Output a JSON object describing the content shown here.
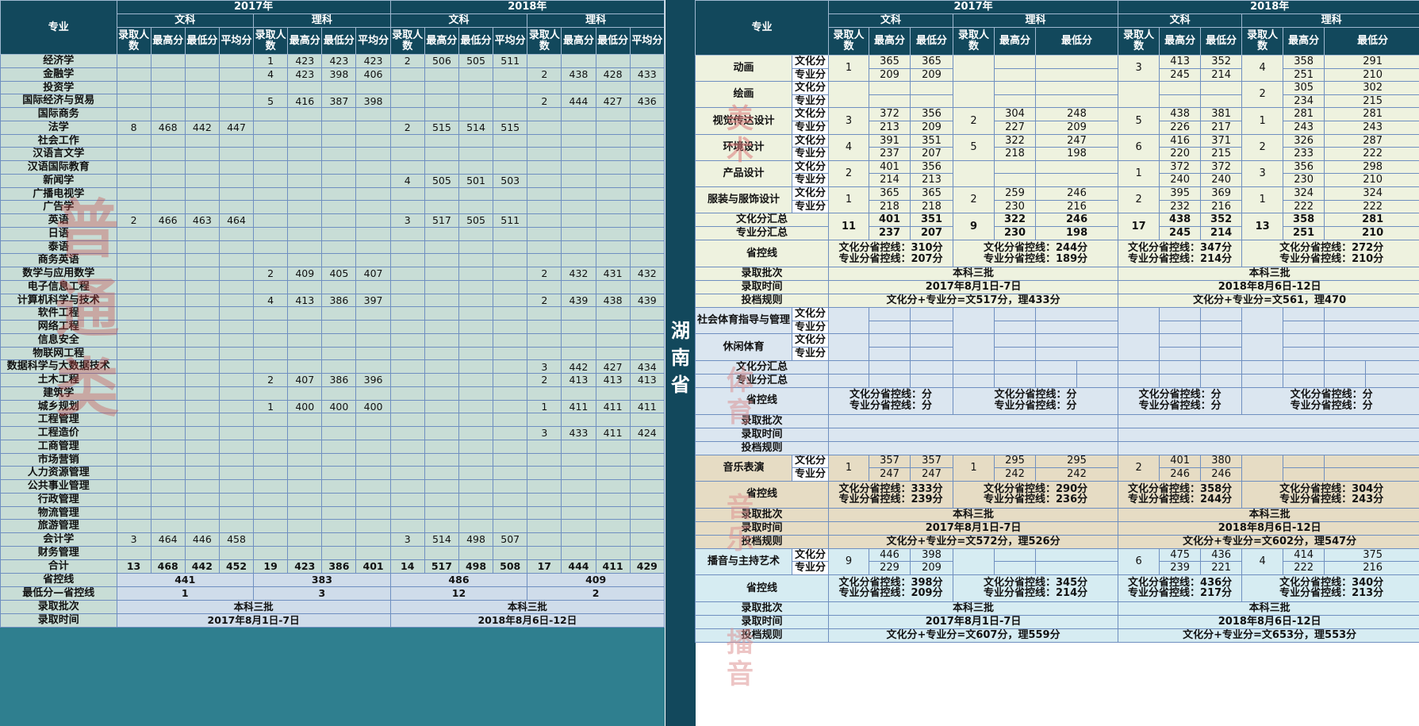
{
  "province": "湖南省",
  "left": {
    "header": {
      "major": "专业",
      "years": [
        "2017年",
        "2018年"
      ],
      "tracks": [
        "文科",
        "理科"
      ],
      "cols": [
        "录取人数",
        "最高分",
        "最低分",
        "平均分"
      ]
    },
    "rows": [
      {
        "name": "经济学",
        "v": [
          "",
          "",
          "",
          "",
          "1",
          "423",
          "423",
          "423",
          "2",
          "506",
          "505",
          "511",
          "",
          "",
          "",
          ""
        ]
      },
      {
        "name": "金融学",
        "v": [
          "",
          "",
          "",
          "",
          "4",
          "423",
          "398",
          "406",
          "",
          "",
          "",
          "",
          "2",
          "438",
          "428",
          "433"
        ]
      },
      {
        "name": "投资学",
        "v": [
          "",
          "",
          "",
          "",
          "",
          "",
          "",
          "",
          "",
          "",
          "",
          "",
          "",
          "",
          "",
          ""
        ]
      },
      {
        "name": "国际经济与贸易",
        "v": [
          "",
          "",
          "",
          "",
          "5",
          "416",
          "387",
          "398",
          "",
          "",
          "",
          "",
          "2",
          "444",
          "427",
          "436"
        ]
      },
      {
        "name": "国际商务",
        "v": [
          "",
          "",
          "",
          "",
          "",
          "",
          "",
          "",
          "",
          "",
          "",
          "",
          "",
          "",
          "",
          ""
        ]
      },
      {
        "name": "法学",
        "v": [
          "8",
          "468",
          "442",
          "447",
          "",
          "",
          "",
          "",
          "2",
          "515",
          "514",
          "515",
          "",
          "",
          "",
          ""
        ]
      },
      {
        "name": "社会工作",
        "v": [
          "",
          "",
          "",
          "",
          "",
          "",
          "",
          "",
          "",
          "",
          "",
          "",
          "",
          "",
          "",
          ""
        ]
      },
      {
        "name": "汉语言文学",
        "v": [
          "",
          "",
          "",
          "",
          "",
          "",
          "",
          "",
          "",
          "",
          "",
          "",
          "",
          "",
          "",
          ""
        ]
      },
      {
        "name": "汉语国际教育",
        "v": [
          "",
          "",
          "",
          "",
          "",
          "",
          "",
          "",
          "",
          "",
          "",
          "",
          "",
          "",
          "",
          ""
        ]
      },
      {
        "name": "新闻学",
        "v": [
          "",
          "",
          "",
          "",
          "",
          "",
          "",
          "",
          "4",
          "505",
          "501",
          "503",
          "",
          "",
          "",
          ""
        ]
      },
      {
        "name": "广播电视学",
        "v": [
          "",
          "",
          "",
          "",
          "",
          "",
          "",
          "",
          "",
          "",
          "",
          "",
          "",
          "",
          "",
          ""
        ]
      },
      {
        "name": "广告学",
        "v": [
          "",
          "",
          "",
          "",
          "",
          "",
          "",
          "",
          "",
          "",
          "",
          "",
          "",
          "",
          "",
          ""
        ]
      },
      {
        "name": "英语",
        "v": [
          "2",
          "466",
          "463",
          "464",
          "",
          "",
          "",
          "",
          "3",
          "517",
          "505",
          "511",
          "",
          "",
          "",
          ""
        ]
      },
      {
        "name": "日语",
        "v": [
          "",
          "",
          "",
          "",
          "",
          "",
          "",
          "",
          "",
          "",
          "",
          "",
          "",
          "",
          "",
          ""
        ]
      },
      {
        "name": "泰语",
        "v": [
          "",
          "",
          "",
          "",
          "",
          "",
          "",
          "",
          "",
          "",
          "",
          "",
          "",
          "",
          "",
          ""
        ]
      },
      {
        "name": "商务英语",
        "v": [
          "",
          "",
          "",
          "",
          "",
          "",
          "",
          "",
          "",
          "",
          "",
          "",
          "",
          "",
          "",
          ""
        ]
      },
      {
        "name": "数学与应用数学",
        "v": [
          "",
          "",
          "",
          "",
          "2",
          "409",
          "405",
          "407",
          "",
          "",
          "",
          "",
          "2",
          "432",
          "431",
          "432"
        ]
      },
      {
        "name": "电子信息工程",
        "v": [
          "",
          "",
          "",
          "",
          "",
          "",
          "",
          "",
          "",
          "",
          "",
          "",
          "",
          "",
          "",
          ""
        ]
      },
      {
        "name": "计算机科学与技术",
        "v": [
          "",
          "",
          "",
          "",
          "4",
          "413",
          "386",
          "397",
          "",
          "",
          "",
          "",
          "2",
          "439",
          "438",
          "439"
        ]
      },
      {
        "name": "软件工程",
        "v": [
          "",
          "",
          "",
          "",
          "",
          "",
          "",
          "",
          "",
          "",
          "",
          "",
          "",
          "",
          "",
          ""
        ]
      },
      {
        "name": "网络工程",
        "v": [
          "",
          "",
          "",
          "",
          "",
          "",
          "",
          "",
          "",
          "",
          "",
          "",
          "",
          "",
          "",
          ""
        ]
      },
      {
        "name": "信息安全",
        "v": [
          "",
          "",
          "",
          "",
          "",
          "",
          "",
          "",
          "",
          "",
          "",
          "",
          "",
          "",
          "",
          ""
        ]
      },
      {
        "name": "物联网工程",
        "v": [
          "",
          "",
          "",
          "",
          "",
          "",
          "",
          "",
          "",
          "",
          "",
          "",
          "",
          "",
          "",
          ""
        ]
      },
      {
        "name": "数据科学与大数据技术",
        "v": [
          "",
          "",
          "",
          "",
          "",
          "",
          "",
          "",
          "",
          "",
          "",
          "",
          "3",
          "442",
          "427",
          "434"
        ]
      },
      {
        "name": "土木工程",
        "v": [
          "",
          "",
          "",
          "",
          "2",
          "407",
          "386",
          "396",
          "",
          "",
          "",
          "",
          "2",
          "413",
          "413",
          "413"
        ]
      },
      {
        "name": "建筑学",
        "v": [
          "",
          "",
          "",
          "",
          "",
          "",
          "",
          "",
          "",
          "",
          "",
          "",
          "",
          "",
          "",
          ""
        ]
      },
      {
        "name": "城乡规划",
        "v": [
          "",
          "",
          "",
          "",
          "1",
          "400",
          "400",
          "400",
          "",
          "",
          "",
          "",
          "1",
          "411",
          "411",
          "411"
        ]
      },
      {
        "name": "工程管理",
        "v": [
          "",
          "",
          "",
          "",
          "",
          "",
          "",
          "",
          "",
          "",
          "",
          "",
          "",
          "",
          "",
          ""
        ]
      },
      {
        "name": "工程造价",
        "v": [
          "",
          "",
          "",
          "",
          "",
          "",
          "",
          "",
          "",
          "",
          "",
          "",
          "3",
          "433",
          "411",
          "424"
        ]
      },
      {
        "name": "工商管理",
        "v": [
          "",
          "",
          "",
          "",
          "",
          "",
          "",
          "",
          "",
          "",
          "",
          "",
          "",
          "",
          "",
          ""
        ]
      },
      {
        "name": "市场营销",
        "v": [
          "",
          "",
          "",
          "",
          "",
          "",
          "",
          "",
          "",
          "",
          "",
          "",
          "",
          "",
          "",
          ""
        ]
      },
      {
        "name": "人力资源管理",
        "v": [
          "",
          "",
          "",
          "",
          "",
          "",
          "",
          "",
          "",
          "",
          "",
          "",
          "",
          "",
          "",
          ""
        ]
      },
      {
        "name": "公共事业管理",
        "v": [
          "",
          "",
          "",
          "",
          "",
          "",
          "",
          "",
          "",
          "",
          "",
          "",
          "",
          "",
          "",
          ""
        ]
      },
      {
        "name": "行政管理",
        "v": [
          "",
          "",
          "",
          "",
          "",
          "",
          "",
          "",
          "",
          "",
          "",
          "",
          "",
          "",
          "",
          ""
        ]
      },
      {
        "name": "物流管理",
        "v": [
          "",
          "",
          "",
          "",
          "",
          "",
          "",
          "",
          "",
          "",
          "",
          "",
          "",
          "",
          "",
          ""
        ]
      },
      {
        "name": "旅游管理",
        "v": [
          "",
          "",
          "",
          "",
          "",
          "",
          "",
          "",
          "",
          "",
          "",
          "",
          "",
          "",
          "",
          ""
        ]
      },
      {
        "name": "会计学",
        "v": [
          "3",
          "464",
          "446",
          "458",
          "",
          "",
          "",
          "",
          "3",
          "514",
          "498",
          "507",
          "",
          "",
          "",
          ""
        ]
      },
      {
        "name": "财务管理",
        "v": [
          "",
          "",
          "",
          "",
          "",
          "",
          "",
          "",
          "",
          "",
          "",
          "",
          "",
          "",
          "",
          ""
        ]
      }
    ],
    "total": {
      "name": "合计",
      "v": [
        "13",
        "468",
        "442",
        "452",
        "19",
        "423",
        "386",
        "401",
        "14",
        "517",
        "498",
        "508",
        "17",
        "444",
        "411",
        "429"
      ]
    },
    "footer": {
      "control": {
        "label": "省控线",
        "v": [
          "441",
          "383",
          "486",
          "409"
        ]
      },
      "diff": {
        "label": "最低分—省控线",
        "v": [
          "1",
          "3",
          "12",
          "2"
        ]
      },
      "batch": {
        "label": "录取批次",
        "v": [
          "本科三批",
          "本科三批"
        ]
      },
      "time": {
        "label": "录取时间",
        "v": [
          "2017年8月1日-7日",
          "2018年8月6日-12日"
        ]
      }
    }
  },
  "right": {
    "header": {
      "major": "专业",
      "years": [
        "2017年",
        "2018年"
      ],
      "tracks": [
        "文科",
        "理科"
      ],
      "cols": [
        "录取人数",
        "最高分",
        "最低分"
      ]
    },
    "labels": {
      "culture": "文化分",
      "pro": "专业分",
      "control": "省控线",
      "batch": "录取批次",
      "time": "录取时间",
      "rule": "投档规则",
      "culture_sum": "文化分汇总",
      "pro_sum": "专业分汇总"
    },
    "fine_arts": {
      "watermark": "美术",
      "rows": [
        {
          "name": "动画",
          "n": [
            "1",
            "",
            "3",
            "4"
          ],
          "c": [
            "365",
            "365",
            "",
            "",
            "413",
            "352",
            "358",
            "291"
          ],
          "p": [
            "209",
            "209",
            "",
            "",
            "245",
            "214",
            "251",
            "210"
          ]
        },
        {
          "name": "绘画",
          "n": [
            "",
            "",
            "",
            "2"
          ],
          "c": [
            "",
            "",
            "",
            "",
            "",
            "",
            "305",
            "302"
          ],
          "p": [
            "",
            "",
            "",
            "",
            "",
            "",
            "234",
            "215"
          ]
        },
        {
          "name": "视觉传达设计",
          "n": [
            "3",
            "2",
            "5",
            "1"
          ],
          "c": [
            "372",
            "356",
            "304",
            "248",
            "438",
            "381",
            "281",
            "281"
          ],
          "p": [
            "213",
            "209",
            "227",
            "209",
            "226",
            "217",
            "243",
            "243"
          ]
        },
        {
          "name": "环境设计",
          "n": [
            "4",
            "5",
            "6",
            "2"
          ],
          "c": [
            "391",
            "351",
            "322",
            "247",
            "416",
            "371",
            "326",
            "287"
          ],
          "p": [
            "237",
            "207",
            "218",
            "198",
            "220",
            "215",
            "233",
            "222"
          ]
        },
        {
          "name": "产品设计",
          "n": [
            "2",
            "",
            "1",
            "3"
          ],
          "c": [
            "401",
            "356",
            "",
            "",
            "372",
            "372",
            "356",
            "298"
          ],
          "p": [
            "214",
            "213",
            "",
            "",
            "240",
            "240",
            "230",
            "210"
          ]
        },
        {
          "name": "服装与服饰设计",
          "n": [
            "1",
            "2",
            "2",
            "1"
          ],
          "c": [
            "365",
            "365",
            "259",
            "246",
            "395",
            "369",
            "324",
            "324"
          ],
          "p": [
            "218",
            "218",
            "230",
            "216",
            "232",
            "216",
            "222",
            "222"
          ]
        }
      ],
      "summary": {
        "n": [
          "11",
          "9",
          "17",
          "13"
        ],
        "c": [
          "401",
          "351",
          "322",
          "246",
          "438",
          "352",
          "358",
          "281"
        ],
        "p": [
          "237",
          "207",
          "230",
          "198",
          "245",
          "214",
          "251",
          "210"
        ]
      },
      "control": {
        "culture": [
          "文化分省控线：310分",
          "文化分省控线：244分",
          "文化分省控线：347分",
          "文化分省控线：272分"
        ],
        "pro": [
          "专业分省控线：207分",
          "专业分省控线：189分",
          "专业分省控线：214分",
          "专业分省控线：210分"
        ]
      },
      "batch": [
        "本科三批",
        "本科三批"
      ],
      "time": [
        "2017年8月1日-7日",
        "2018年8月6日-12日"
      ],
      "rule": [
        "文化分+专业分=文517分，理433分",
        "文化分+专业分=文561，理470"
      ]
    },
    "sports": {
      "watermark": "体育",
      "rows": [
        {
          "name": "社会体育指导与管理"
        },
        {
          "name": "休闲体育"
        }
      ],
      "control": {
        "culture": [
          "文化分省控线：分",
          "文化分省控线：分",
          "文化分省控线：分",
          "文化分省控线：分"
        ],
        "pro": [
          "专业分省控线：分",
          "专业分省控线：分",
          "专业分省控线：分",
          "专业分省控线：分"
        ]
      }
    },
    "music": {
      "watermark": "音乐",
      "row": {
        "name": "音乐表演",
        "n": [
          "1",
          "1",
          "2",
          ""
        ],
        "c": [
          "357",
          "357",
          "295",
          "295",
          "401",
          "380",
          "",
          ""
        ],
        "p": [
          "247",
          "247",
          "242",
          "242",
          "246",
          "246",
          "",
          ""
        ]
      },
      "control": {
        "culture": [
          "文化分省控线：333分",
          "文化分省控线：290分",
          "文化分省控线：358分",
          "文化分省控线：304分"
        ],
        "pro": [
          "专业分省控线：239分",
          "专业分省控线：236分",
          "专业分省控线：244分",
          "专业分省控线：243分"
        ]
      },
      "batch": [
        "本科三批",
        "本科三批"
      ],
      "time": [
        "2017年8月1日-7日",
        "2018年8月6日-12日"
      ],
      "rule": [
        "文化分+专业分=文572分，理526分",
        "文化分+专业分=文602分，理547分"
      ]
    },
    "broadcast": {
      "watermark": "播音",
      "row": {
        "name": "播音与主持艺术",
        "n": [
          "9",
          "",
          "6",
          "4"
        ],
        "c": [
          "446",
          "398",
          "",
          "",
          "475",
          "436",
          "414",
          "375"
        ],
        "p": [
          "229",
          "209",
          "",
          "",
          "239",
          "221",
          "222",
          "216"
        ]
      },
      "control": {
        "culture": [
          "文化分省控线：398分",
          "文化分省控线：345分",
          "文化分省控线：436分",
          "文化分省控线：340分"
        ],
        "pro": [
          "专业分省控线：209分",
          "专业分省控线：214分",
          "专业分省控线：217分",
          "专业分省控线：213分"
        ]
      },
      "batch": [
        "本科三批",
        "本科三批"
      ],
      "time": [
        "2017年8月1日-7日",
        "2018年8月6日-12日"
      ],
      "rule": [
        "文化分+专业分=文607分，理559分",
        "文化分+专业分=文653分，理553分"
      ]
    }
  }
}
